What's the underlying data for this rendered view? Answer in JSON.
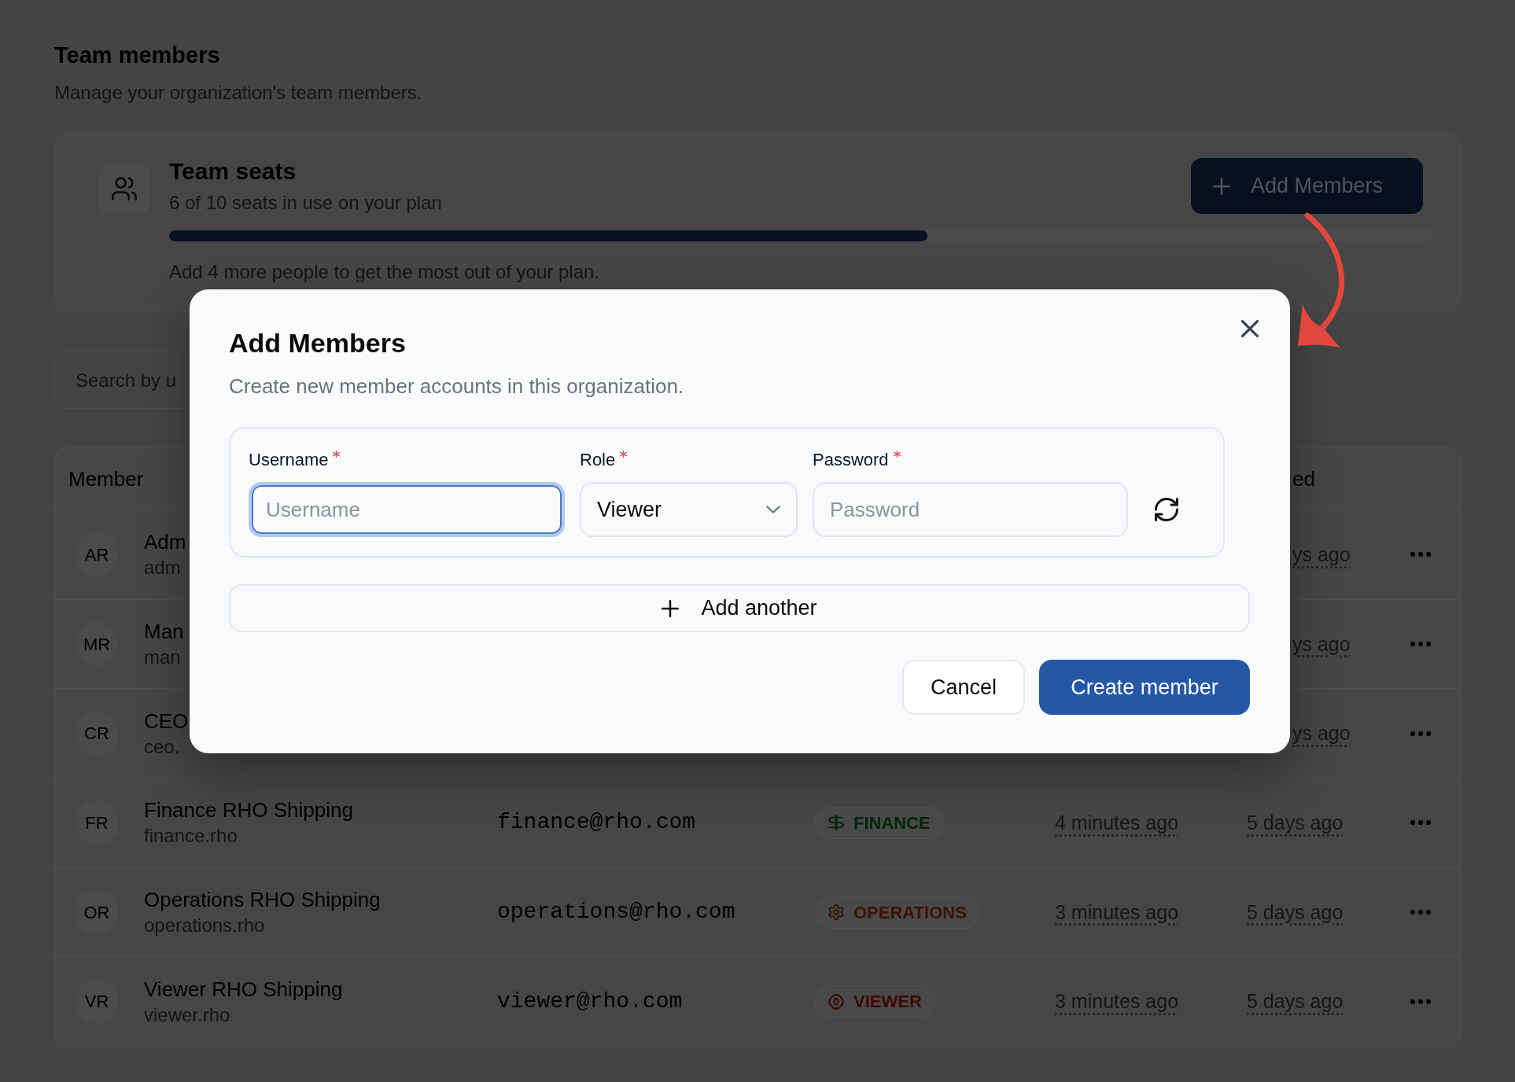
{
  "page": {
    "title": "Team members",
    "subtitle": "Manage your organization's team members."
  },
  "seats_card": {
    "title": "Team seats",
    "usage": "6 of 10 seats in use on your plan",
    "level": 0.6,
    "hint": "Add 4 more people to get the most out of your plan.",
    "button": "Add Members"
  },
  "search": {
    "placeholder": "Search by u"
  },
  "table": {
    "headers": {
      "member": "Member",
      "column_5": "ed"
    },
    "rows": [
      {
        "initials": "AR",
        "name": "Adm",
        "username": "adm",
        "column_5": "ys ago"
      },
      {
        "initials": "MR",
        "name": "Man",
        "username": "man",
        "column_5": "ys ago"
      },
      {
        "initials": "CR",
        "name": "CEO",
        "username": "ceo.",
        "column_5": "ys ago"
      },
      {
        "initials": "FR",
        "name": "Finance RHO Shipping",
        "username": "finance.rho",
        "column_2": "finance@rho.com",
        "column_3": {
          "label": "FINANCE",
          "kind": "finance",
          "color": "#00260c"
        },
        "column_4": "4 minutes ago",
        "column_5": "5 days ago"
      },
      {
        "initials": "OR",
        "name": "Operations RHO Shipping",
        "username": "operations.rho",
        "column_2": "operations@rho.com",
        "column_3": {
          "label": "OPERATIONS",
          "kind": "operations",
          "color": "#3a1400"
        },
        "column_4": "3 minutes ago",
        "column_5": "5 days ago"
      },
      {
        "initials": "VR",
        "name": "Viewer RHO Shipping",
        "username": "viewer.rho",
        "column_2": "viewer@rho.com",
        "column_3": {
          "label": "VIEWER",
          "kind": "viewer",
          "color": "#3d0a05"
        },
        "column_4": "3 minutes ago",
        "column_5": "5 days ago"
      }
    ]
  },
  "dialog": {
    "title": "Add Members",
    "description": "Create new member accounts in this organization.",
    "fields": [
      {
        "kind": "text",
        "label": "Username",
        "required": true,
        "placeholder": "Username",
        "focused": true
      },
      {
        "kind": "select",
        "label": "Role",
        "required": true,
        "value": "Viewer",
        "focused": false
      },
      {
        "kind": "password",
        "label": "Password",
        "required": true,
        "placeholder": "Password",
        "focused": false
      }
    ],
    "add_another": "Add another",
    "buttons": [
      {
        "label": "Cancel",
        "kind": "secondary"
      },
      {
        "label": "Create member",
        "kind": "primary"
      }
    ]
  }
}
